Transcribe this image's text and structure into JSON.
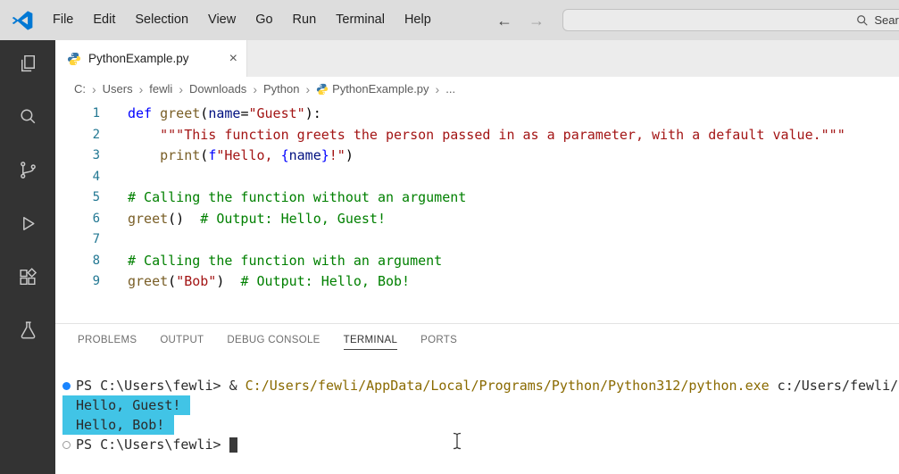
{
  "colors": {
    "titlebar_bg": "#dddddd",
    "activitybar_bg": "#333333",
    "editor_bg": "#ffffff",
    "tabbar_bg": "#ececec",
    "logo_accent": "#0078d4",
    "keyword": "#0000ff",
    "function": "#795e26",
    "parameter": "#001080",
    "string": "#a31515",
    "comment": "#008000",
    "line_number": "#237893",
    "terminal_command": "#8a6a00",
    "terminal_selection": "#41c4e6",
    "command_decoration": "#1a85ff"
  },
  "icons": {
    "close": "×",
    "chevron": "›",
    "back_arrow": "←",
    "forward_arrow": "→"
  },
  "titlebar": {
    "menus": [
      "File",
      "Edit",
      "Selection",
      "View",
      "Go",
      "Run",
      "Terminal",
      "Help"
    ],
    "search_placeholder": "Search"
  },
  "activity_bar": {
    "icons": [
      "files-icon",
      "search-icon",
      "source-control-icon",
      "run-debug-icon",
      "extensions-icon",
      "testing-icon"
    ]
  },
  "editor": {
    "tab": {
      "label": "PythonExample.py",
      "icon": "python-icon"
    },
    "breadcrumb": [
      {
        "label": "C:"
      },
      {
        "label": "Users"
      },
      {
        "label": "fewli"
      },
      {
        "label": "Downloads"
      },
      {
        "label": "Python"
      },
      {
        "label": "PythonExample.py",
        "icon": "python-icon"
      },
      {
        "label": "..."
      }
    ],
    "lines": [
      {
        "num": "1",
        "tokens": [
          {
            "t": "def",
            "c": "kw"
          },
          {
            "t": " ",
            "c": "pl"
          },
          {
            "t": "greet",
            "c": "fn"
          },
          {
            "t": "(",
            "c": "pl"
          },
          {
            "t": "name",
            "c": "param"
          },
          {
            "t": "=",
            "c": "pl"
          },
          {
            "t": "\"Guest\"",
            "c": "str"
          },
          {
            "t": "):",
            "c": "pl"
          }
        ]
      },
      {
        "num": "2",
        "tokens": [
          {
            "t": "    \"\"\"This function greets the person passed in as a parameter, with a default value.\"\"\"",
            "c": "str"
          }
        ]
      },
      {
        "num": "3",
        "tokens": [
          {
            "t": "    ",
            "c": "pl"
          },
          {
            "t": "print",
            "c": "fn"
          },
          {
            "t": "(",
            "c": "pl"
          },
          {
            "t": "f",
            "c": "kw"
          },
          {
            "t": "\"Hello, ",
            "c": "str"
          },
          {
            "t": "{",
            "c": "kw"
          },
          {
            "t": "name",
            "c": "param"
          },
          {
            "t": "}",
            "c": "kw"
          },
          {
            "t": "!\"",
            "c": "str"
          },
          {
            "t": ")",
            "c": "pl"
          }
        ]
      },
      {
        "num": "4",
        "tokens": []
      },
      {
        "num": "5",
        "tokens": [
          {
            "t": "# Calling the function without an argument",
            "c": "com"
          }
        ]
      },
      {
        "num": "6",
        "tokens": [
          {
            "t": "greet",
            "c": "fn"
          },
          {
            "t": "()  ",
            "c": "pl"
          },
          {
            "t": "# Output: Hello, Guest!",
            "c": "com"
          }
        ]
      },
      {
        "num": "7",
        "tokens": []
      },
      {
        "num": "8",
        "tokens": [
          {
            "t": "# Calling the function with an argument",
            "c": "com"
          }
        ]
      },
      {
        "num": "9",
        "tokens": [
          {
            "t": "greet",
            "c": "fn"
          },
          {
            "t": "(",
            "c": "pl"
          },
          {
            "t": "\"Bob\"",
            "c": "str"
          },
          {
            "t": ")  ",
            "c": "pl"
          },
          {
            "t": "# Output: Hello, Bob!",
            "c": "com"
          }
        ]
      }
    ]
  },
  "panel": {
    "tabs": [
      "PROBLEMS",
      "OUTPUT",
      "DEBUG CONSOLE",
      "TERMINAL",
      "PORTS"
    ],
    "active_tab": "TERMINAL"
  },
  "terminal": {
    "lines": [
      {
        "gutter": "filled",
        "segments": [
          {
            "t": "PS C:\\Users\\fewli> ",
            "c": "fg"
          },
          {
            "t": "& ",
            "c": "fg"
          },
          {
            "t": "C:/Users/fewli/AppData/Local/Programs/Python/Python312/python.exe",
            "c": "cmd"
          },
          {
            "t": " c:/Users/fewli/D",
            "c": "fg"
          }
        ]
      },
      {
        "highlight": true,
        "segments": [
          {
            "t": "Hello, Guest!",
            "c": "fg"
          }
        ]
      },
      {
        "highlight": true,
        "segments": [
          {
            "t": "Hello, Bob!",
            "c": "fg"
          }
        ]
      },
      {
        "gutter": "hollow",
        "cursor": true,
        "segments": [
          {
            "t": "PS C:\\Users\\fewli> ",
            "c": "fg"
          }
        ]
      }
    ]
  }
}
